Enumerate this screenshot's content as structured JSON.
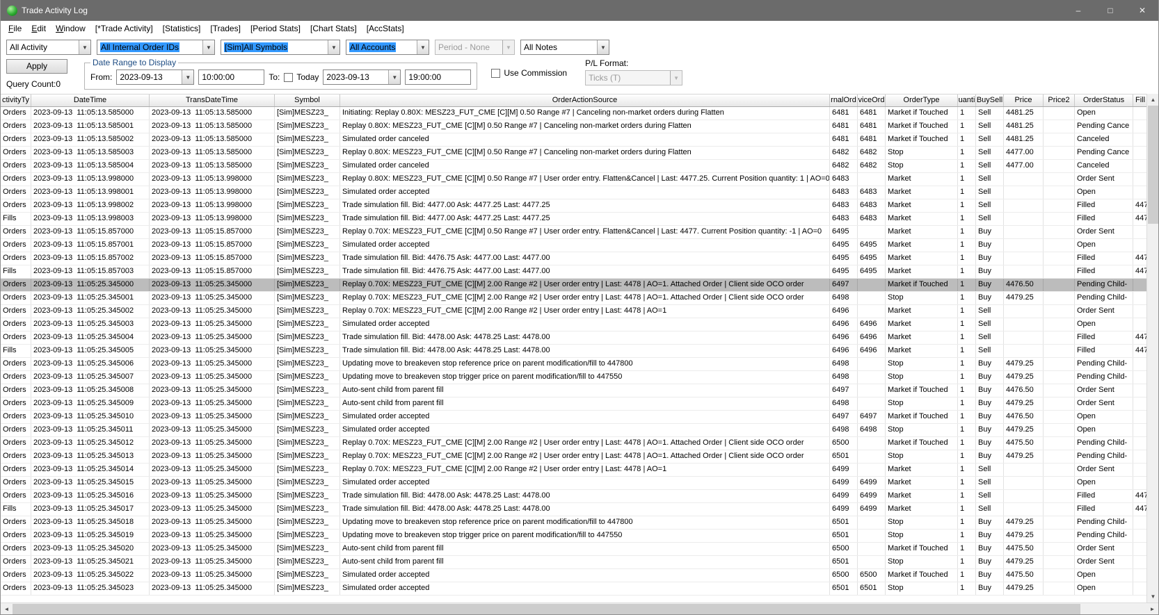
{
  "window": {
    "title": "Trade Activity Log"
  },
  "icons": {
    "minimize": "–",
    "maximize": "□",
    "close": "✕",
    "chevron_down": "▼",
    "scroll_up": "▲",
    "scroll_down": "▼",
    "scroll_left": "◄",
    "scroll_right": "►"
  },
  "menu": {
    "items": [
      "File",
      "Edit",
      "Window",
      "[*Trade Activity]",
      "[Statistics]",
      "[Trades]",
      "[Period Stats]",
      "[Chart Stats]",
      "[AccStats]"
    ]
  },
  "filters": {
    "activity": {
      "value": "All Activity",
      "highlighted": false
    },
    "internal_order_ids": {
      "value": "All Internal Order IDs",
      "highlighted": true
    },
    "symbols": {
      "value": "[Sim]All Symbols",
      "highlighted": true
    },
    "accounts": {
      "value": "All Accounts",
      "highlighted": true
    },
    "period": {
      "value": "Period - None",
      "disabled": true
    },
    "notes": {
      "value": "All Notes",
      "highlighted": false
    }
  },
  "controls": {
    "apply_label": "Apply",
    "query_count": "Query Count:0",
    "use_commission_label": "Use Commission",
    "pl_format_label": "P/L Format:",
    "pl_format_value": "Ticks (T)"
  },
  "date_range": {
    "title": "Date Range to Display",
    "from_label": "From:",
    "from_date": "2023-09-13",
    "from_time": "10:00:00",
    "to_label": "To:",
    "today_label": "Today",
    "to_date": "2023-09-13",
    "to_time": "19:00:00"
  },
  "table": {
    "columns": [
      "ctivityTy",
      "DateTime",
      "TransDateTime",
      "Symbol",
      "OrderActionSource",
      "rnalOrd",
      "viceOrd",
      "OrderType",
      "uanti",
      "BuySell",
      "Price",
      "Price2",
      "OrderStatus",
      "Fill"
    ],
    "selected_index": 13,
    "rows": [
      [
        "Orders",
        "2023-09-13  11:05:13.585000",
        "2023-09-13  11:05:13.585000",
        "[Sim]MESZ23_",
        "Initiating: Replay 0.80X: MESZ23_FUT_CME [C][M] 0.50 Range #7 | Canceling non-market orders during Flatten",
        "6481",
        "6481",
        "Market if Touched",
        "1",
        "Sell",
        "4481.25",
        "",
        "Open",
        ""
      ],
      [
        "Orders",
        "2023-09-13  11:05:13.585001",
        "2023-09-13  11:05:13.585000",
        "[Sim]MESZ23_",
        "Replay 0.80X: MESZ23_FUT_CME [C][M] 0.50 Range #7 | Canceling non-market orders during Flatten",
        "6481",
        "6481",
        "Market if Touched",
        "1",
        "Sell",
        "4481.25",
        "",
        "Pending Cance",
        ""
      ],
      [
        "Orders",
        "2023-09-13  11:05:13.585002",
        "2023-09-13  11:05:13.585000",
        "[Sim]MESZ23_",
        "Simulated order canceled",
        "6481",
        "6481",
        "Market if Touched",
        "1",
        "Sell",
        "4481.25",
        "",
        "Canceled",
        ""
      ],
      [
        "Orders",
        "2023-09-13  11:05:13.585003",
        "2023-09-13  11:05:13.585000",
        "[Sim]MESZ23_",
        "Replay 0.80X: MESZ23_FUT_CME [C][M] 0.50 Range #7 | Canceling non-market orders during Flatten",
        "6482",
        "6482",
        "Stop",
        "1",
        "Sell",
        "4477.00",
        "",
        "Pending Cance",
        ""
      ],
      [
        "Orders",
        "2023-09-13  11:05:13.585004",
        "2023-09-13  11:05:13.585000",
        "[Sim]MESZ23_",
        "Simulated order canceled",
        "6482",
        "6482",
        "Stop",
        "1",
        "Sell",
        "4477.00",
        "",
        "Canceled",
        ""
      ],
      [
        "Orders",
        "2023-09-13  11:05:13.998000",
        "2023-09-13  11:05:13.998000",
        "[Sim]MESZ23_",
        "Replay 0.80X: MESZ23_FUT_CME [C][M] 0.50 Range #7 | User order entry. Flatten&Cancel | Last: 4477.25. Current Position quantity: 1 | AO=0",
        "6483",
        "",
        "Market",
        "1",
        "Sell",
        "",
        "",
        "Order Sent",
        ""
      ],
      [
        "Orders",
        "2023-09-13  11:05:13.998001",
        "2023-09-13  11:05:13.998000",
        "[Sim]MESZ23_",
        "Simulated order accepted",
        "6483",
        "6483",
        "Market",
        "1",
        "Sell",
        "",
        "",
        "Open",
        ""
      ],
      [
        "Orders",
        "2023-09-13  11:05:13.998002",
        "2023-09-13  11:05:13.998000",
        "[Sim]MESZ23_",
        "Trade simulation fill. Bid: 4477.00 Ask: 4477.25 Last: 4477.25",
        "6483",
        "6483",
        "Market",
        "1",
        "Sell",
        "",
        "",
        "Filled",
        "447"
      ],
      [
        "Fills",
        "2023-09-13  11:05:13.998003",
        "2023-09-13  11:05:13.998000",
        "[Sim]MESZ23_",
        "Trade simulation fill. Bid: 4477.00 Ask: 4477.25 Last: 4477.25",
        "6483",
        "6483",
        "Market",
        "1",
        "Sell",
        "",
        "",
        "Filled",
        "447"
      ],
      [
        "Orders",
        "2023-09-13  11:05:15.857000",
        "2023-09-13  11:05:15.857000",
        "[Sim]MESZ23_",
        "Replay 0.70X: MESZ23_FUT_CME [C][M] 0.50 Range #7 | User order entry. Flatten&Cancel | Last: 4477. Current Position quantity: -1 | AO=0",
        "6495",
        "",
        "Market",
        "1",
        "Buy",
        "",
        "",
        "Order Sent",
        ""
      ],
      [
        "Orders",
        "2023-09-13  11:05:15.857001",
        "2023-09-13  11:05:15.857000",
        "[Sim]MESZ23_",
        "Simulated order accepted",
        "6495",
        "6495",
        "Market",
        "1",
        "Buy",
        "",
        "",
        "Open",
        ""
      ],
      [
        "Orders",
        "2023-09-13  11:05:15.857002",
        "2023-09-13  11:05:15.857000",
        "[Sim]MESZ23_",
        "Trade simulation fill. Bid: 4476.75 Ask: 4477.00 Last: 4477.00",
        "6495",
        "6495",
        "Market",
        "1",
        "Buy",
        "",
        "",
        "Filled",
        "447"
      ],
      [
        "Fills",
        "2023-09-13  11:05:15.857003",
        "2023-09-13  11:05:15.857000",
        "[Sim]MESZ23_",
        "Trade simulation fill. Bid: 4476.75 Ask: 4477.00 Last: 4477.00",
        "6495",
        "6495",
        "Market",
        "1",
        "Buy",
        "",
        "",
        "Filled",
        "447"
      ],
      [
        "Orders",
        "2023-09-13  11:05:25.345000",
        "2023-09-13  11:05:25.345000",
        "[Sim]MESZ23_",
        "Replay 0.70X: MESZ23_FUT_CME [C][M] 2.00 Range #2 | User order entry | Last: 4478 | AO=1. Attached Order | Client side OCO order",
        "6497",
        "",
        "Market if Touched",
        "1",
        "Buy",
        "4476.50",
        "",
        "Pending Child-",
        ""
      ],
      [
        "Orders",
        "2023-09-13  11:05:25.345001",
        "2023-09-13  11:05:25.345000",
        "[Sim]MESZ23_",
        "Replay 0.70X: MESZ23_FUT_CME [C][M] 2.00 Range #2 | User order entry | Last: 4478 | AO=1. Attached Order | Client side OCO order",
        "6498",
        "",
        "Stop",
        "1",
        "Buy",
        "4479.25",
        "",
        "Pending Child-",
        ""
      ],
      [
        "Orders",
        "2023-09-13  11:05:25.345002",
        "2023-09-13  11:05:25.345000",
        "[Sim]MESZ23_",
        "Replay 0.70X: MESZ23_FUT_CME [C][M] 2.00 Range #2 | User order entry | Last: 4478 | AO=1",
        "6496",
        "",
        "Market",
        "1",
        "Sell",
        "",
        "",
        "Order Sent",
        ""
      ],
      [
        "Orders",
        "2023-09-13  11:05:25.345003",
        "2023-09-13  11:05:25.345000",
        "[Sim]MESZ23_",
        "Simulated order accepted",
        "6496",
        "6496",
        "Market",
        "1",
        "Sell",
        "",
        "",
        "Open",
        ""
      ],
      [
        "Orders",
        "2023-09-13  11:05:25.345004",
        "2023-09-13  11:05:25.345000",
        "[Sim]MESZ23_",
        "Trade simulation fill. Bid: 4478.00 Ask: 4478.25 Last: 4478.00",
        "6496",
        "6496",
        "Market",
        "1",
        "Sell",
        "",
        "",
        "Filled",
        "447"
      ],
      [
        "Fills",
        "2023-09-13  11:05:25.345005",
        "2023-09-13  11:05:25.345000",
        "[Sim]MESZ23_",
        "Trade simulation fill. Bid: 4478.00 Ask: 4478.25 Last: 4478.00",
        "6496",
        "6496",
        "Market",
        "1",
        "Sell",
        "",
        "",
        "Filled",
        "447"
      ],
      [
        "Orders",
        "2023-09-13  11:05:25.345006",
        "2023-09-13  11:05:25.345000",
        "[Sim]MESZ23_",
        "Updating move to breakeven stop reference price on parent modification/fill to 447800",
        "6498",
        "",
        "Stop",
        "1",
        "Buy",
        "4479.25",
        "",
        "Pending Child-",
        ""
      ],
      [
        "Orders",
        "2023-09-13  11:05:25.345007",
        "2023-09-13  11:05:25.345000",
        "[Sim]MESZ23_",
        "Updating move to breakeven stop trigger price on parent modification/fill to 447550",
        "6498",
        "",
        "Stop",
        "1",
        "Buy",
        "4479.25",
        "",
        "Pending Child-",
        ""
      ],
      [
        "Orders",
        "2023-09-13  11:05:25.345008",
        "2023-09-13  11:05:25.345000",
        "[Sim]MESZ23_",
        "Auto-sent child from parent fill",
        "6497",
        "",
        "Market if Touched",
        "1",
        "Buy",
        "4476.50",
        "",
        "Order Sent",
        ""
      ],
      [
        "Orders",
        "2023-09-13  11:05:25.345009",
        "2023-09-13  11:05:25.345000",
        "[Sim]MESZ23_",
        "Auto-sent child from parent fill",
        "6498",
        "",
        "Stop",
        "1",
        "Buy",
        "4479.25",
        "",
        "Order Sent",
        ""
      ],
      [
        "Orders",
        "2023-09-13  11:05:25.345010",
        "2023-09-13  11:05:25.345000",
        "[Sim]MESZ23_",
        "Simulated order accepted",
        "6497",
        "6497",
        "Market if Touched",
        "1",
        "Buy",
        "4476.50",
        "",
        "Open",
        ""
      ],
      [
        "Orders",
        "2023-09-13  11:05:25.345011",
        "2023-09-13  11:05:25.345000",
        "[Sim]MESZ23_",
        "Simulated order accepted",
        "6498",
        "6498",
        "Stop",
        "1",
        "Buy",
        "4479.25",
        "",
        "Open",
        ""
      ],
      [
        "Orders",
        "2023-09-13  11:05:25.345012",
        "2023-09-13  11:05:25.345000",
        "[Sim]MESZ23_",
        "Replay 0.70X: MESZ23_FUT_CME [C][M] 2.00 Range #2 | User order entry | Last: 4478 | AO=1. Attached Order | Client side OCO order",
        "6500",
        "",
        "Market if Touched",
        "1",
        "Buy",
        "4475.50",
        "",
        "Pending Child-",
        ""
      ],
      [
        "Orders",
        "2023-09-13  11:05:25.345013",
        "2023-09-13  11:05:25.345000",
        "[Sim]MESZ23_",
        "Replay 0.70X: MESZ23_FUT_CME [C][M] 2.00 Range #2 | User order entry | Last: 4478 | AO=1. Attached Order | Client side OCO order",
        "6501",
        "",
        "Stop",
        "1",
        "Buy",
        "4479.25",
        "",
        "Pending Child-",
        ""
      ],
      [
        "Orders",
        "2023-09-13  11:05:25.345014",
        "2023-09-13  11:05:25.345000",
        "[Sim]MESZ23_",
        "Replay 0.70X: MESZ23_FUT_CME [C][M] 2.00 Range #2 | User order entry | Last: 4478 | AO=1",
        "6499",
        "",
        "Market",
        "1",
        "Sell",
        "",
        "",
        "Order Sent",
        ""
      ],
      [
        "Orders",
        "2023-09-13  11:05:25.345015",
        "2023-09-13  11:05:25.345000",
        "[Sim]MESZ23_",
        "Simulated order accepted",
        "6499",
        "6499",
        "Market",
        "1",
        "Sell",
        "",
        "",
        "Open",
        ""
      ],
      [
        "Orders",
        "2023-09-13  11:05:25.345016",
        "2023-09-13  11:05:25.345000",
        "[Sim]MESZ23_",
        "Trade simulation fill. Bid: 4478.00 Ask: 4478.25 Last: 4478.00",
        "6499",
        "6499",
        "Market",
        "1",
        "Sell",
        "",
        "",
        "Filled",
        "447"
      ],
      [
        "Fills",
        "2023-09-13  11:05:25.345017",
        "2023-09-13  11:05:25.345000",
        "[Sim]MESZ23_",
        "Trade simulation fill. Bid: 4478.00 Ask: 4478.25 Last: 4478.00",
        "6499",
        "6499",
        "Market",
        "1",
        "Sell",
        "",
        "",
        "Filled",
        "447"
      ],
      [
        "Orders",
        "2023-09-13  11:05:25.345018",
        "2023-09-13  11:05:25.345000",
        "[Sim]MESZ23_",
        "Updating move to breakeven stop reference price on parent modification/fill to 447800",
        "6501",
        "",
        "Stop",
        "1",
        "Buy",
        "4479.25",
        "",
        "Pending Child-",
        ""
      ],
      [
        "Orders",
        "2023-09-13  11:05:25.345019",
        "2023-09-13  11:05:25.345000",
        "[Sim]MESZ23_",
        "Updating move to breakeven stop trigger price on parent modification/fill to 447550",
        "6501",
        "",
        "Stop",
        "1",
        "Buy",
        "4479.25",
        "",
        "Pending Child-",
        ""
      ],
      [
        "Orders",
        "2023-09-13  11:05:25.345020",
        "2023-09-13  11:05:25.345000",
        "[Sim]MESZ23_",
        "Auto-sent child from parent fill",
        "6500",
        "",
        "Market if Touched",
        "1",
        "Buy",
        "4475.50",
        "",
        "Order Sent",
        ""
      ],
      [
        "Orders",
        "2023-09-13  11:05:25.345021",
        "2023-09-13  11:05:25.345000",
        "[Sim]MESZ23_",
        "Auto-sent child from parent fill",
        "6501",
        "",
        "Stop",
        "1",
        "Buy",
        "4479.25",
        "",
        "Order Sent",
        ""
      ],
      [
        "Orders",
        "2023-09-13  11:05:25.345022",
        "2023-09-13  11:05:25.345000",
        "[Sim]MESZ23_",
        "Simulated order accepted",
        "6500",
        "6500",
        "Market if Touched",
        "1",
        "Buy",
        "4475.50",
        "",
        "Open",
        ""
      ],
      [
        "Orders",
        "2023-09-13  11:05:25.345023",
        "2023-09-13  11:05:25.345000",
        "[Sim]MESZ23_",
        "Simulated order accepted",
        "6501",
        "6501",
        "Stop",
        "1",
        "Buy",
        "4479.25",
        "",
        "Open",
        ""
      ]
    ]
  }
}
